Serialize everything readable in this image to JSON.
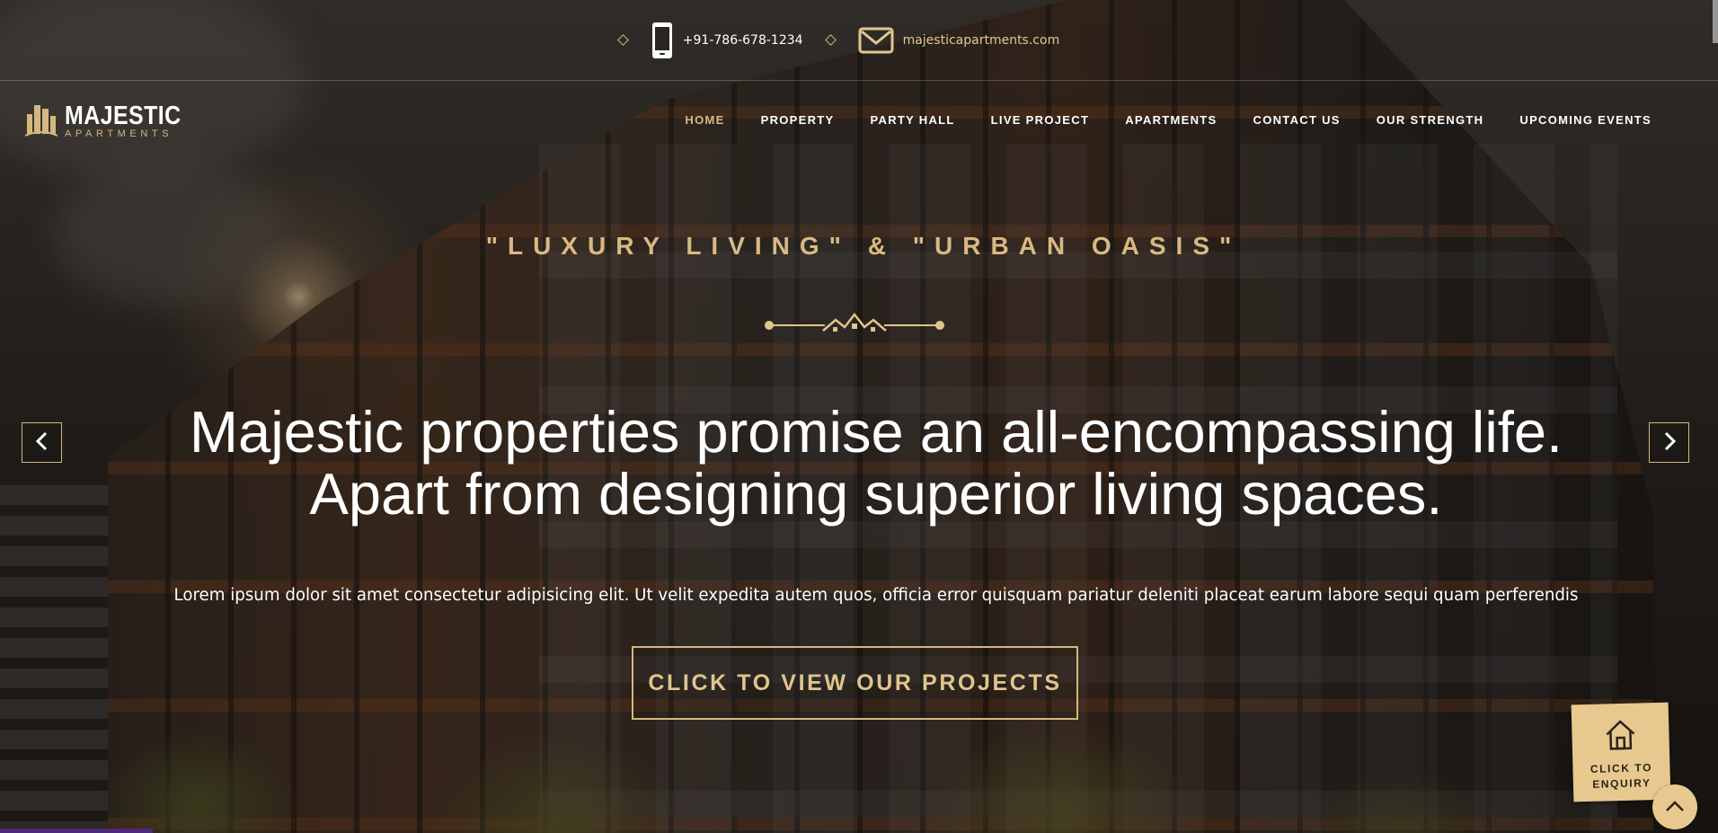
{
  "topbar": {
    "phone": "+91-786-678-1234",
    "email": "majesticapartments.com",
    "phone_icon": "mobile-phone-icon",
    "email_icon": "envelope-icon",
    "separator_icon": "diamond-icon"
  },
  "logo": {
    "name": "MAJESTIC",
    "sub": "APARTMENTS",
    "icon": "buildings-logo-icon"
  },
  "nav": {
    "items": [
      {
        "label": "HOME",
        "active": true
      },
      {
        "label": "PROPERTY",
        "active": false
      },
      {
        "label": "PARTY HALL",
        "active": false
      },
      {
        "label": "LIVE PROJECT",
        "active": false
      },
      {
        "label": "APARTMENTS",
        "active": false
      },
      {
        "label": "CONTACT US",
        "active": false
      },
      {
        "label": "OUR STRENGTH",
        "active": false
      },
      {
        "label": "UPCOMING EVENTS",
        "active": false
      }
    ]
  },
  "hero": {
    "tagline": "\"LUXURY LIVING\" & \"URBAN OASIS\"",
    "headline_line1": "Majestic properties promise an all-encompassing life.",
    "headline_line2": "Apart from designing superior living spaces.",
    "description": "Lorem ipsum dolor sit amet consectetur adipisicing elit. Ut velit expedita autem quos, officia error quisquam pariatur deleniti placeat earum labore sequi quam perferendis",
    "cta_label": "CLICK TO VIEW OUR PROJECTS",
    "divider_icon": "houses-divider-icon"
  },
  "slider": {
    "prev_icon": "chevron-left-icon",
    "next_icon": "chevron-right-icon"
  },
  "enquiry": {
    "label": "CLICK TO ENQUIRY",
    "icon": "house-icon"
  },
  "scroll_top": {
    "icon": "chevron-up-icon"
  },
  "colors": {
    "accent": "#d9b981",
    "widget": "#e7c98f",
    "text": "#ffffff"
  }
}
